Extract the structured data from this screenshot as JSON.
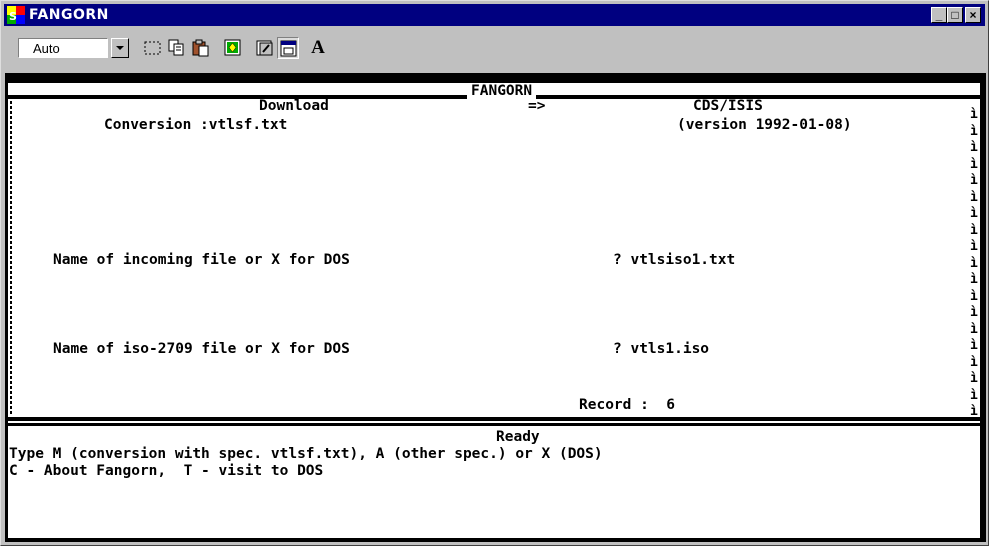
{
  "window": {
    "title": "FANGORN",
    "minimize": "_",
    "maximize": "□",
    "close": "×"
  },
  "toolbar": {
    "font_select": "Auto",
    "font_button": "A"
  },
  "terminal": {
    "header_title": "FANGORN",
    "download": "Download",
    "arrow": "=>",
    "cds_isis": "CDS/ISIS",
    "conversion": "Conversion :vtlsf.txt",
    "version": "(version 1992-01-08)",
    "prompt1_label": "Name of incoming file or X for DOS",
    "prompt1_value": "? vtlsiso1.txt",
    "prompt2_label": "Name of iso-2709 file or X for DOS",
    "prompt2_value": "? vtls1.iso",
    "record": "Record :  6",
    "right_glyph": "ì"
  },
  "status": {
    "ready": "Ready",
    "line1": "Type M (conversion with spec. vtlsf.txt), A (other spec.) or X (DOS)",
    "line2": "C - About Fangorn,  T - visit to DOS"
  },
  "icons": [
    "app-icon",
    "dropdown-arrow-icon",
    "select-rect-icon",
    "copy-icon",
    "paste-icon",
    "fullscreen-icon",
    "properties-icon",
    "background-icon",
    "font-icon"
  ]
}
